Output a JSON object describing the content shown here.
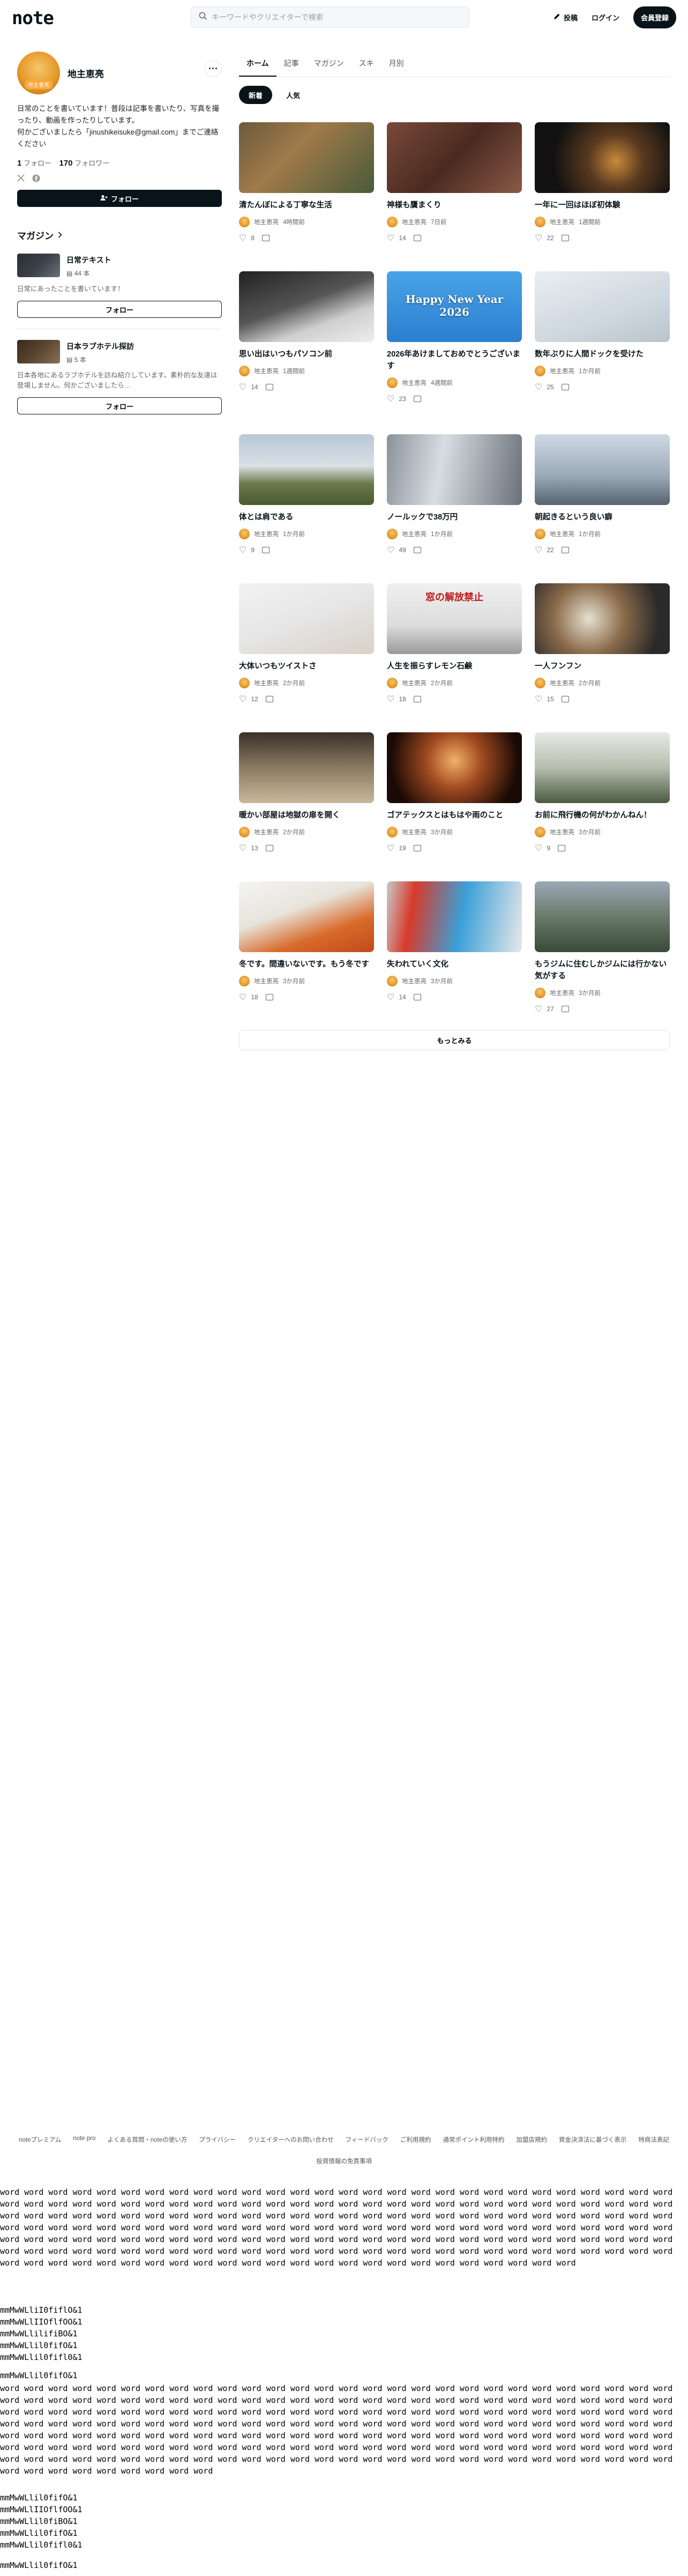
{
  "header": {
    "logo": "note",
    "search_placeholder": "キーワードやクリエイターで検索",
    "post_label": "投稿",
    "login_label": "ログイン",
    "signup_label": "会員登録"
  },
  "profile": {
    "name": "地主恵亮",
    "avatar_tag": "地主恵亮",
    "bio": "日常のことを書いています！普段は記事を書いたり、写真を撮ったり、動画を作ったりしています。\n何かございましたら「jinushikeisuke@gmail.com」までご連絡ください",
    "follow_count": "1",
    "follow_label": "フォロー",
    "follower_count": "170",
    "follower_label": "フォロワー",
    "follow_button": "フォロー",
    "more_icon": "more-dots-icon"
  },
  "magazines": {
    "heading": "マガジン",
    "items": [
      {
        "title": "日常テキスト",
        "count": "44 本",
        "desc": "日常にあったことを書いています！",
        "follow": "フォロー",
        "color": "#3b4048"
      },
      {
        "title": "日本ラブホテル探訪",
        "count": "5 本",
        "desc": "日本各地にあるラブホテルを訪ね紹介しています。素朴的な友達は登場しません。何かございましたら…",
        "follow": "フォロー",
        "color": "#5a4630"
      }
    ]
  },
  "tabs": [
    "ホーム",
    "記事",
    "マガジン",
    "スキ",
    "月別"
  ],
  "subtabs": [
    "新着",
    "人気"
  ],
  "articles": [
    {
      "title": "清たんぼによる丁寧な生活",
      "author": "地主恵亮",
      "time": "4時間前",
      "likes": "8",
      "bg": "linear-gradient(135deg,#6b5a3c,#a07a4a 40%,#4a5a3a)"
    },
    {
      "title": "神様も贋まくり",
      "author": "地主恵亮",
      "time": "7日前",
      "likes": "14",
      "bg": "linear-gradient(135deg,#7a4a3a,#4a2a20 50%,#8a5a48)"
    },
    {
      "title": "一年に一回はほぼ初体験",
      "author": "地主恵亮",
      "time": "1週間前",
      "likes": "22",
      "bg": "radial-gradient(circle at 60% 55%,#c98a3a 0,#5a3a20 30%,#111 70%)"
    },
    {
      "title": "思い出はいつもパソコン前",
      "author": "地主恵亮",
      "time": "1週間前",
      "likes": "14",
      "bg": "linear-gradient(160deg,#222,#555 45%,#cfcfcf 70%,#eee)"
    },
    {
      "title": "2026年あけましておめでとうございます",
      "author": "地主恵亮",
      "time": "4週間前",
      "likes": "23",
      "bg": "linear-gradient(180deg,#4aa3e6,#2a7fd0)",
      "overlay": "Happy New Year 2026"
    },
    {
      "title": "数年ぶりに人間ドックを受けた",
      "author": "地主恵亮",
      "time": "1か月前",
      "likes": "25",
      "bg": "linear-gradient(160deg,#e9eef2,#cfd8df 60%,#b8c4cc)"
    },
    {
      "title": "体とは肩である",
      "author": "地主恵亮",
      "time": "1か月前",
      "likes": "9",
      "bg": "linear-gradient(180deg,#b9c8d6 0,#d8e0e6 45%,#6a7a4a 70%,#4a5a30)"
    },
    {
      "title": "ノールックで38万円",
      "author": "地主恵亮",
      "time": "1か月前",
      "likes": "49",
      "bg": "linear-gradient(100deg,#8a929a,#d8dde2 40%,#6a7078)"
    },
    {
      "title": "朝起きるという良い癖",
      "author": "地主恵亮",
      "time": "1か月前",
      "likes": "22",
      "bg": "linear-gradient(180deg,#cfd9e4,#9aa8b6 60%,#556270)"
    },
    {
      "title": "大体いつもツイストさ",
      "author": "地主恵亮",
      "time": "2か月前",
      "likes": "12",
      "bg": "linear-gradient(160deg,#f2f2f2,#e6e6e6 50%,#d8d0c4)"
    },
    {
      "title": "人生を振らすレモン石鹸",
      "author": "地主恵亮",
      "time": "2か月前",
      "likes": "18",
      "bg": "linear-gradient(180deg,#f0f0f0,#dcdcdc 60%,#9a9a9a)",
      "overlay": "窓の解放禁止"
    },
    {
      "title": "一人フンフン",
      "author": "地主恵亮",
      "time": "2か月前",
      "likes": "15",
      "bg": "radial-gradient(circle at 40% 50%,#e6e0d0 0,#8a6a4a 40%,#2a2a2a 80%)"
    },
    {
      "title": "暖かい部屋は地獄の扉を開く",
      "author": "地主恵亮",
      "time": "2か月前",
      "likes": "13",
      "bg": "linear-gradient(180deg,#3a3028,#8a7a62 50%,#c8b89a)"
    },
    {
      "title": "ゴアテックスとはもはや雨のこと",
      "author": "地主恵亮",
      "time": "3か月前",
      "likes": "19",
      "bg": "radial-gradient(circle at 50% 40%,#f2b06a 0,#a04a20 35%,#1a0a05 80%)"
    },
    {
      "title": "お前に飛行機の何がわかんねん！",
      "author": "地主恵亮",
      "time": "3か月前",
      "likes": "9",
      "bg": "linear-gradient(180deg,#e8eae6,#b6beae 50%,#4a5a40)"
    },
    {
      "title": "冬です。間違いないです。もう冬です",
      "author": "地主恵亮",
      "time": "3か月前",
      "likes": "18",
      "bg": "linear-gradient(160deg,#f4f4f4,#e8e4dc 40%,#d86a2a 70%,#c04a1a)"
    },
    {
      "title": "失われていく文化",
      "author": "地主恵亮",
      "time": "3か月前",
      "likes": "14",
      "bg": "linear-gradient(100deg,#c8c8c8,#d83a2a 20%,#3aa0d8 55%,#e8e8e8)"
    },
    {
      "title": "もうジムに住むしかジムには行かない気がする",
      "author": "地主恵亮",
      "time": "3か月前",
      "likes": "27",
      "bg": "linear-gradient(180deg,#9aa8b6,#6a7a6a 50%,#3a4a38)"
    }
  ],
  "more_button": "もっとみる",
  "footer": {
    "links": [
      "noteプレミアム",
      "note pro",
      "よくある質問・noteの使い方",
      "プライバシー",
      "クリエイターへのお問い合わせ",
      "フィードバック",
      "ご利用規約",
      "通常ポイント利用特約",
      "加盟店規約",
      "資金決済法に基づく表示",
      "特商法表記"
    ],
    "sub": "投資情報の免責事項"
  },
  "debug": {
    "block1": "word word word word word word word word word word word word word word word word word word word word word word word word word word word word word word word word word word word word word word word word word word word word word word word word word word word word word word word word word word word word word word word word word word word word word word word word word word word word word word word word word word word word word word word word word word word word word word word word word word word word word word word word word word word word word word word word word word word word word word word word word word word word word word word word word word word word word word word word word word word word word word word word word word word word word word word word word word word word word word word word word word word word word word word word word word word word word word word word word word word word word word word word word word word word word word word word",
    "mono1": "mmMwWLliI0fiflO&1\nmmMwWLlIIOflfOO&1\nmmMwWLlilifiBO&1\nmmMwWLlil0fifO&1\nmmMwWLlil0fifl0&1",
    "mono2": "mmMwWLlil0fifO&1",
    "block2": "word word word word word word word word word word word word word word word word word word word word word word word word word word word word word word word word word word word word word word word word word word word word word word word word word word word word word word word word word word word word word word word word word word word word word word word word word word word word word word word word word word word word word word word word word word word word word word word word word word word word word word word word word word word word word word word word word word word word word word word word word word word word word word word word word word word word word word word word word word word word word word word word word word word word word word word word word word word word word word word word word word word word word word word word word word word word word word word word word word word word word word word word word word word word word word word word word word word word word word word word word word word word word",
    "mono3": "mmMwWLlil0fifO&1\nmmMwWLlIIOflfOO&1\nmmMwWLlil0fiBO&1\nmmMwWLlil0fifO&1\nmmMwWLlil0fifl0&1",
    "mono4": "mmMwWLlil0fifO&1"
  }
}
